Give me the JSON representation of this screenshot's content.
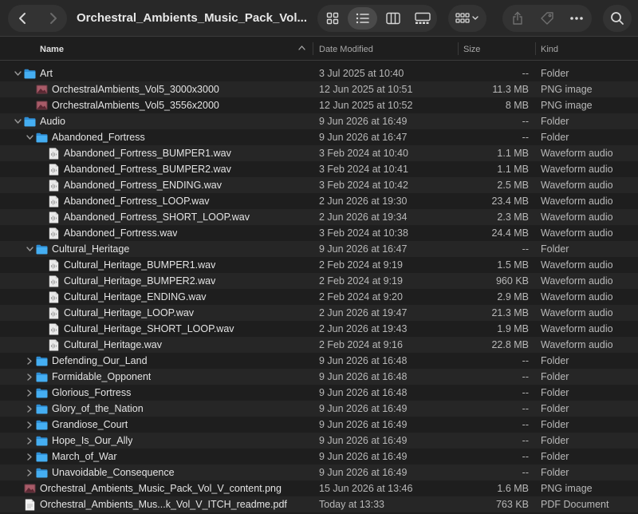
{
  "window": {
    "title": "Orchestral_Ambients_Music_Pack_Vol..."
  },
  "toolbar": {
    "back_icon": "chevron-left-icon",
    "forward_icon": "chevron-right-icon",
    "views": [
      "icon-view-icon",
      "list-view-icon",
      "column-view-icon",
      "gallery-view-icon"
    ],
    "active_view": "list",
    "group_icon": "group-by-icon",
    "share_icon": "share-icon",
    "tag_icon": "tag-icon",
    "more_icon": "ellipsis-icon",
    "search_icon": "search-icon"
  },
  "columns": {
    "name": "Name",
    "date": "Date Modified",
    "size": "Size",
    "kind": "Kind"
  },
  "colors": {
    "folder": "#3ea6f0",
    "background": "#1e1e1e",
    "alt_row": "#262626"
  },
  "rows": [
    {
      "level": 0,
      "disclosure": "open",
      "icon": "folder",
      "name": "Art",
      "date": "3 Jul 2025 at 10:40",
      "size": "--",
      "kind": "Folder"
    },
    {
      "level": 1,
      "disclosure": "none",
      "icon": "image",
      "name": "OrchestralAmbients_Vol5_3000x3000",
      "date": "12 Jun 2025 at 10:51",
      "size": "11.3 MB",
      "kind": "PNG image"
    },
    {
      "level": 1,
      "disclosure": "none",
      "icon": "image",
      "name": "OrchestralAmbients_Vol5_3556x2000",
      "date": "12 Jun 2025 at 10:52",
      "size": "8 MB",
      "kind": "PNG image"
    },
    {
      "level": 0,
      "disclosure": "open",
      "icon": "folder",
      "name": "Audio",
      "date": "9 Jun 2026 at 16:49",
      "size": "--",
      "kind": "Folder"
    },
    {
      "level": 1,
      "disclosure": "open",
      "icon": "folder",
      "name": "Abandoned_Fortress",
      "date": "9 Jun 2026 at 16:47",
      "size": "--",
      "kind": "Folder"
    },
    {
      "level": 2,
      "disclosure": "none",
      "icon": "audio",
      "name": "Abandoned_Fortress_BUMPER1.wav",
      "date": "3 Feb 2024 at 10:40",
      "size": "1.1 MB",
      "kind": "Waveform audio"
    },
    {
      "level": 2,
      "disclosure": "none",
      "icon": "audio",
      "name": "Abandoned_Fortress_BUMPER2.wav",
      "date": "3 Feb 2024 at 10:41",
      "size": "1.1 MB",
      "kind": "Waveform audio"
    },
    {
      "level": 2,
      "disclosure": "none",
      "icon": "audio",
      "name": "Abandoned_Fortress_ENDING.wav",
      "date": "3 Feb 2024 at 10:42",
      "size": "2.5 MB",
      "kind": "Waveform audio"
    },
    {
      "level": 2,
      "disclosure": "none",
      "icon": "audio",
      "name": "Abandoned_Fortress_LOOP.wav",
      "date": "2 Jun 2026 at 19:30",
      "size": "23.4 MB",
      "kind": "Waveform audio"
    },
    {
      "level": 2,
      "disclosure": "none",
      "icon": "audio",
      "name": "Abandoned_Fortress_SHORT_LOOP.wav",
      "date": "2 Jun 2026 at 19:34",
      "size": "2.3 MB",
      "kind": "Waveform audio"
    },
    {
      "level": 2,
      "disclosure": "none",
      "icon": "audio",
      "name": "Abandoned_Fortress.wav",
      "date": "3 Feb 2024 at 10:38",
      "size": "24.4 MB",
      "kind": "Waveform audio"
    },
    {
      "level": 1,
      "disclosure": "open",
      "icon": "folder",
      "name": "Cultural_Heritage",
      "date": "9 Jun 2026 at 16:47",
      "size": "--",
      "kind": "Folder"
    },
    {
      "level": 2,
      "disclosure": "none",
      "icon": "audio",
      "name": "Cultural_Heritage_BUMPER1.wav",
      "date": "2 Feb 2024 at 9:19",
      "size": "1.5 MB",
      "kind": "Waveform audio"
    },
    {
      "level": 2,
      "disclosure": "none",
      "icon": "audio",
      "name": "Cultural_Heritage_BUMPER2.wav",
      "date": "2 Feb 2024 at 9:19",
      "size": "960 KB",
      "kind": "Waveform audio"
    },
    {
      "level": 2,
      "disclosure": "none",
      "icon": "audio",
      "name": "Cultural_Heritage_ENDING.wav",
      "date": "2 Feb 2024 at 9:20",
      "size": "2.9 MB",
      "kind": "Waveform audio"
    },
    {
      "level": 2,
      "disclosure": "none",
      "icon": "audio",
      "name": "Cultural_Heritage_LOOP.wav",
      "date": "2 Jun 2026 at 19:47",
      "size": "21.3 MB",
      "kind": "Waveform audio"
    },
    {
      "level": 2,
      "disclosure": "none",
      "icon": "audio",
      "name": "Cultural_Heritage_SHORT_LOOP.wav",
      "date": "2 Jun 2026 at 19:43",
      "size": "1.9 MB",
      "kind": "Waveform audio"
    },
    {
      "level": 2,
      "disclosure": "none",
      "icon": "audio",
      "name": "Cultural_Heritage.wav",
      "date": "2 Feb 2024 at 9:16",
      "size": "22.8 MB",
      "kind": "Waveform audio"
    },
    {
      "level": 1,
      "disclosure": "closed",
      "icon": "folder",
      "name": "Defending_Our_Land",
      "date": "9 Jun 2026 at 16:48",
      "size": "--",
      "kind": "Folder"
    },
    {
      "level": 1,
      "disclosure": "closed",
      "icon": "folder",
      "name": "Formidable_Opponent",
      "date": "9 Jun 2026 at 16:48",
      "size": "--",
      "kind": "Folder"
    },
    {
      "level": 1,
      "disclosure": "closed",
      "icon": "folder",
      "name": "Glorious_Fortress",
      "date": "9 Jun 2026 at 16:48",
      "size": "--",
      "kind": "Folder"
    },
    {
      "level": 1,
      "disclosure": "closed",
      "icon": "folder",
      "name": "Glory_of_the_Nation",
      "date": "9 Jun 2026 at 16:49",
      "size": "--",
      "kind": "Folder"
    },
    {
      "level": 1,
      "disclosure": "closed",
      "icon": "folder",
      "name": "Grandiose_Court",
      "date": "9 Jun 2026 at 16:49",
      "size": "--",
      "kind": "Folder"
    },
    {
      "level": 1,
      "disclosure": "closed",
      "icon": "folder",
      "name": "Hope_Is_Our_Ally",
      "date": "9 Jun 2026 at 16:49",
      "size": "--",
      "kind": "Folder"
    },
    {
      "level": 1,
      "disclosure": "closed",
      "icon": "folder",
      "name": "March_of_War",
      "date": "9 Jun 2026 at 16:49",
      "size": "--",
      "kind": "Folder"
    },
    {
      "level": 1,
      "disclosure": "closed",
      "icon": "folder",
      "name": "Unavoidable_Consequence",
      "date": "9 Jun 2026 at 16:49",
      "size": "--",
      "kind": "Folder"
    },
    {
      "level": 0,
      "disclosure": "none",
      "icon": "image",
      "name": "Orchestral_Ambients_Music_Pack_Vol_V_content.png",
      "date": "15 Jun 2026 at 13:46",
      "size": "1.6 MB",
      "kind": "PNG image"
    },
    {
      "level": 0,
      "disclosure": "none",
      "icon": "pdf",
      "name": "Orchestral_Ambients_Mus...k_Vol_V_ITCH_readme.pdf",
      "date": "Today at 13:33",
      "size": "763 KB",
      "kind": "PDF Document"
    }
  ]
}
